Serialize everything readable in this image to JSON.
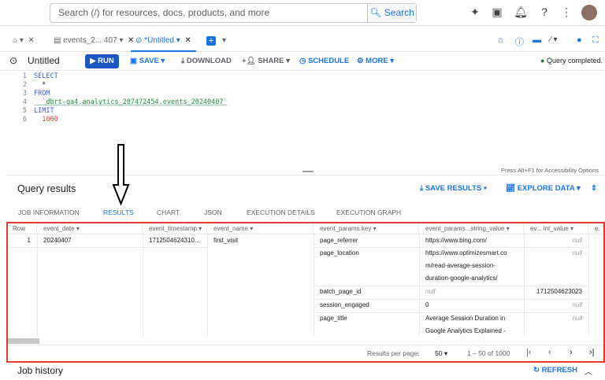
{
  "topbar": {
    "search_placeholder": "Search (/) for resources, docs, products, and more",
    "search_button": "Search"
  },
  "tabs": [
    {
      "label": "events_2... 407"
    },
    {
      "label": "*Untitled"
    }
  ],
  "toolbar": {
    "title": "Untitled",
    "run": "RUN",
    "save": "SAVE",
    "download": "DOWNLOAD",
    "share": "SHARE",
    "schedule": "SCHEDULE",
    "more": "MORE",
    "status": "Query completed."
  },
  "editor": {
    "lines": [
      {
        "n": "1",
        "text": "SELECT"
      },
      {
        "n": "2",
        "text": "  *"
      },
      {
        "n": "3",
        "text": "FROM"
      },
      {
        "n": "4",
        "text": "  `dbrt-ga4.analytics_207472454.events_20240407`"
      },
      {
        "n": "5",
        "text": "LIMIT"
      },
      {
        "n": "6",
        "text": "  1000"
      }
    ],
    "accessibility_hint": "Press Alt+F1 for Accessibility Options"
  },
  "results": {
    "title": "Query results",
    "save_results": "SAVE RESULTS",
    "explore_data": "EXPLORE DATA",
    "tabs": [
      "JOB INFORMATION",
      "RESULTS",
      "CHART",
      "JSON",
      "EXECUTION DETAILS",
      "EXECUTION GRAPH"
    ],
    "active_tab": "RESULTS",
    "columns": [
      "Row",
      "event_date",
      "event_timestamp",
      "event_name",
      "event_params.key",
      "event_params...string_value",
      "ev... int_value",
      "e."
    ],
    "row": {
      "row": "1",
      "event_date": "20240407",
      "event_timestamp": "1712504624310...",
      "event_name": "first_visit"
    },
    "params": [
      {
        "key": "page_referrer",
        "string_value": "https://www.bing.com/",
        "int_value": "null"
      },
      {
        "key": "page_location",
        "string_value": "https://www.optimizesmart.com/read-average-session-duration-google-analytics/",
        "string_lines": [
          "https://www.optimizesmart.co",
          "m/read-average-session-",
          "duration-google-analytics/"
        ],
        "int_value": "null"
      },
      {
        "key": "batch_page_id",
        "string_value": "null",
        "int_value": "1712504623023"
      },
      {
        "key": "session_engaged",
        "string_value": "0",
        "int_value": "null"
      },
      {
        "key": "page_title",
        "string_value": "Average Session Duration in Google Analytics Explained -",
        "string_lines": [
          "Average Session Duration in",
          "Google Analytics Explained -"
        ],
        "int_value": "null"
      }
    ],
    "pagination": {
      "label": "Results per page:",
      "per_page": "50",
      "range": "1 – 50 of 1000"
    }
  },
  "job_history": {
    "title": "Job history",
    "refresh": "REFRESH"
  },
  "colors": {
    "accent": "#1a73e8",
    "run": "#1a56c4",
    "highlight_box": "#e53935",
    "success": "#188038"
  }
}
